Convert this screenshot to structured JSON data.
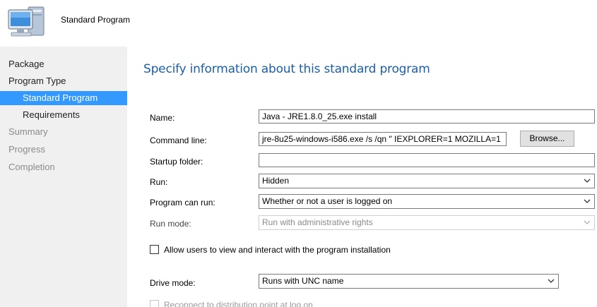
{
  "header": {
    "title": "Standard Program",
    "icon": "computer-icon"
  },
  "sidebar": {
    "items": [
      {
        "label": "Package",
        "state": "normal"
      },
      {
        "label": "Program Type",
        "state": "normal"
      },
      {
        "label": "Standard Program",
        "state": "active"
      },
      {
        "label": "Requirements",
        "state": "normal"
      },
      {
        "label": "Summary",
        "state": "disabled"
      },
      {
        "label": "Progress",
        "state": "disabled"
      },
      {
        "label": "Completion",
        "state": "disabled"
      }
    ]
  },
  "main": {
    "title": "Specify information about this standard program",
    "name": {
      "label": "Name:",
      "value": "Java - JRE1.8.0_25.exe install"
    },
    "command_line": {
      "label": "Command line:",
      "value": "jre-8u25-windows-i586.exe /s /qn \" IEXPLORER=1 MOZILLA=1",
      "browse_label": "Browse..."
    },
    "startup_folder": {
      "label": "Startup folder:",
      "value": ""
    },
    "run": {
      "label": "Run:",
      "value": "Hidden"
    },
    "program_can_run": {
      "label": "Program can run:",
      "value": "Whether or not a user is logged on"
    },
    "run_mode": {
      "label": "Run mode:",
      "value": "Run with administrative rights"
    },
    "allow_users": {
      "label": "Allow users to view and interact with the program installation",
      "checked": false
    },
    "drive_mode": {
      "label": "Drive mode:",
      "value": "Runs with UNC name"
    },
    "reconnect": {
      "label": "Reconnect to distribution point at log on",
      "checked": false
    }
  },
  "colors": {
    "accent": "#3399ff",
    "title": "#1b5faa",
    "sidebar_bg": "#f0f0f0",
    "disabled_text": "#8a8a8a"
  }
}
